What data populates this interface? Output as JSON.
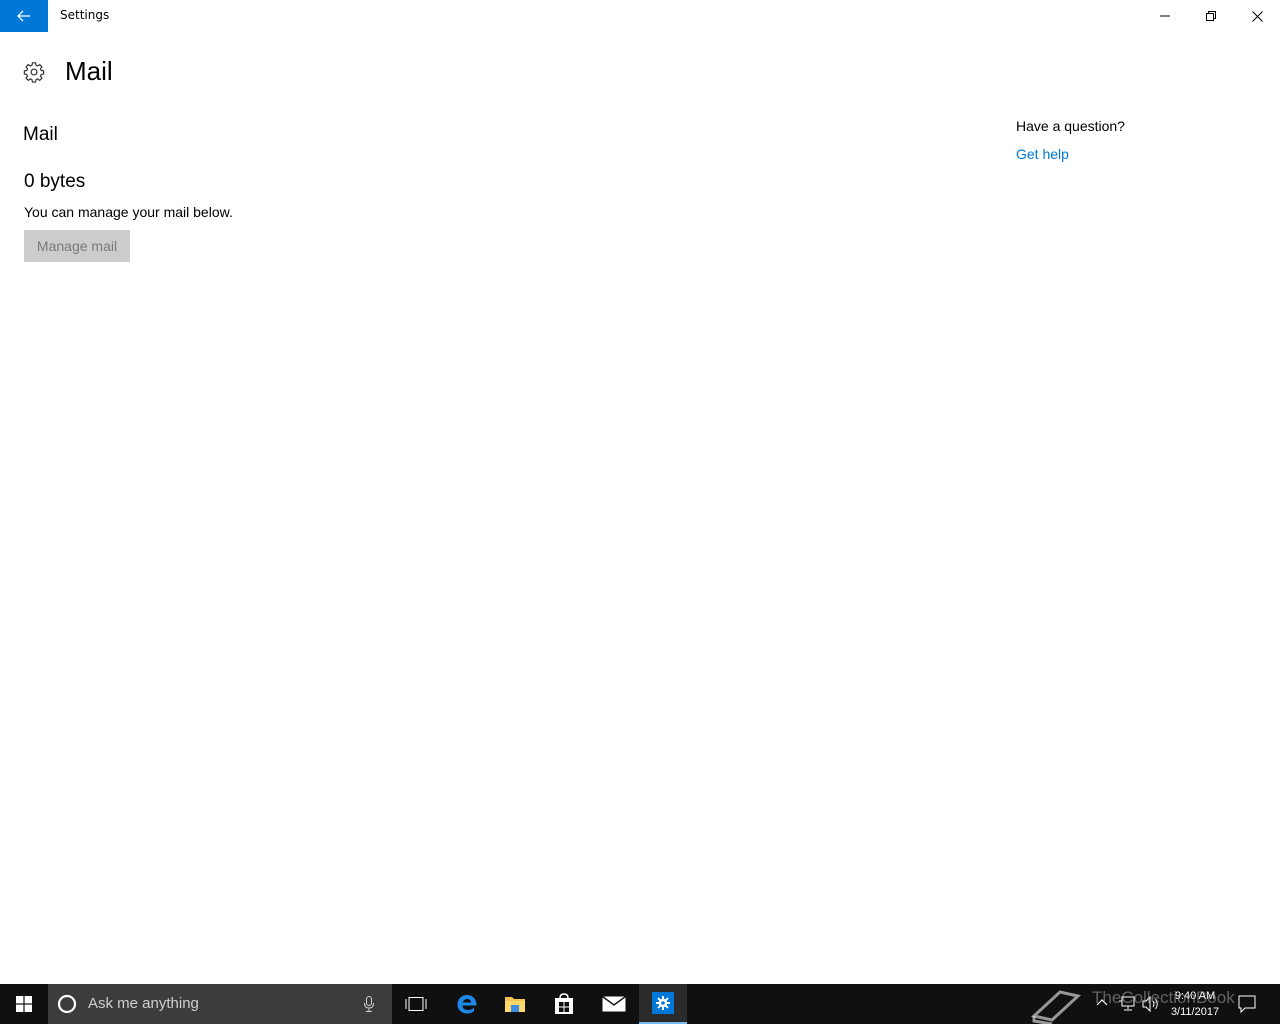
{
  "window": {
    "title": "Settings"
  },
  "page": {
    "title": "Mail",
    "section_title": "Mail",
    "usage_size": "0 bytes",
    "usage_description": "You can manage your mail below.",
    "manage_button_label": "Manage mail"
  },
  "help": {
    "question": "Have a question?",
    "link_label": "Get help"
  },
  "taskbar": {
    "search_placeholder": "Ask me anything",
    "clock_time": "9:40 AM",
    "clock_date": "3/11/2017",
    "pinned": [
      "task-view-icon",
      "edge-icon",
      "file-explorer-icon",
      "store-icon",
      "mail-icon",
      "settings-icon"
    ],
    "watermark_text": "TheCollectionBook"
  },
  "colors": {
    "accent": "#0078d7",
    "taskbar_bg": "#101010",
    "button_disabled_bg": "#cccccc",
    "button_disabled_text": "#7a7a7a"
  }
}
